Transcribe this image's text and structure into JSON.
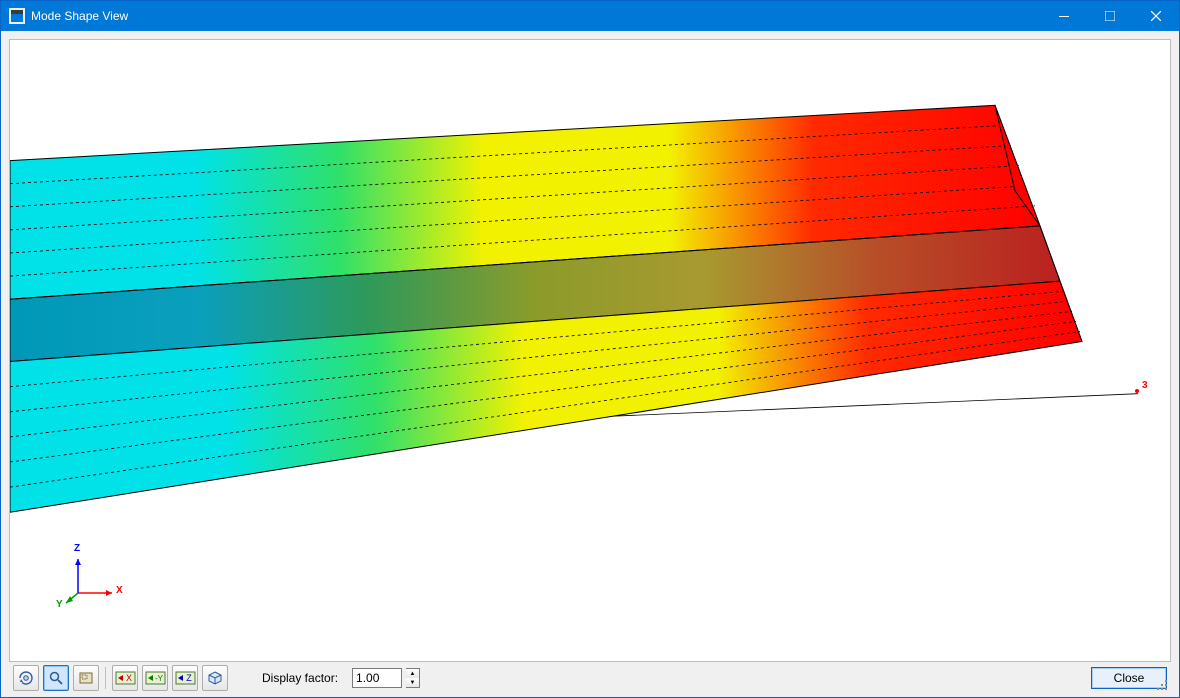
{
  "window": {
    "title": "Mode Shape View"
  },
  "viewport": {
    "node_marker_label": "3",
    "axes": {
      "x": "X",
      "y": "Y",
      "z": "Z"
    },
    "gradient_stops": [
      "#00e2e8",
      "#00e2e8",
      "#2fe06a",
      "#f2f200",
      "#f2f200",
      "#ff0000",
      "#ff0000"
    ]
  },
  "toolbar": {
    "buttons": {
      "rotate": "rotate-3d",
      "zoom": "zoom-magnifier",
      "select": "select-region",
      "view_x": "X",
      "view_ny": "-Y",
      "view_z": "Z",
      "view_iso": "iso"
    },
    "display_factor_label": "Display factor:",
    "display_factor_value": "1.00",
    "close_label": "Close"
  }
}
